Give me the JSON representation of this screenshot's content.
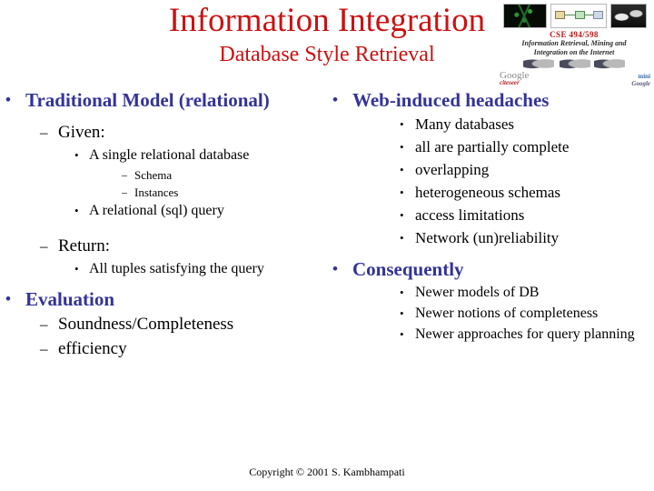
{
  "title": {
    "main": "Information Integration",
    "subtitle": "Database Style Retrieval",
    "color": "#cc1111"
  },
  "banner": {
    "course_code": "CSE 494/598",
    "tagline_line1": "Information Retrieval, Mining and",
    "tagline_line2": "Integration on the Internet",
    "logo_google": "Google",
    "logo_google_sub": "citeseer",
    "logo_right_line1": "mini",
    "logo_right_line2": "Google",
    "thumbnail_network": "network-graph-thumbnail",
    "thumbnail_diagram": "architecture-diagram-thumbnail",
    "thumbnail_photo": "photo-thumbnail",
    "bird_icons": "mining-bird-icons"
  },
  "left_column": {
    "heading_1": "Traditional Model (relational)",
    "heading_1_color": "#333399",
    "given_label": "Given:",
    "given_items": [
      "A single relational database"
    ],
    "given_subitems": [
      "Schema",
      "Instances"
    ],
    "given_items_2": [
      "A relational (sql) query"
    ],
    "return_label": "Return:",
    "return_items": [
      "All tuples satisfying the query"
    ],
    "heading_2": "Evaluation",
    "heading_2_color": "#333399",
    "evaluation_items": [
      "Soundness/Completeness",
      "efficiency"
    ]
  },
  "right_column": {
    "heading_1": "Web-induced headaches",
    "heading_1_color": "#333399",
    "headache_items": [
      "Many databases",
      "all are partially complete",
      "overlapping",
      "heterogeneous schemas",
      "access limitations",
      "Network (un)reliability"
    ],
    "heading_2": "Consequently",
    "heading_2_color": "#333399",
    "consequently_items": [
      "Newer models of DB",
      "Newer notions of completeness",
      "Newer approaches for query planning"
    ]
  },
  "footer": {
    "copyright": "Copyright © 2001 S. Kambhampati"
  },
  "bullets": {
    "round": "•",
    "dash": "–"
  }
}
